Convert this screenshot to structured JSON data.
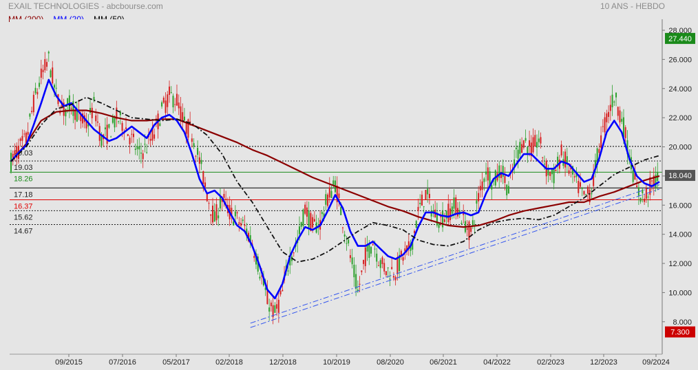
{
  "header": {
    "title": "EXAIL TECHNOLOGIES - abcbourse.com",
    "period": "10 ANS - HEBDO"
  },
  "legend": [
    {
      "label": "MM (200)",
      "color": "#8b0000"
    },
    {
      "label": "MM (20)",
      "color": "#0000ff"
    },
    {
      "label": "MM (50)",
      "color": "#000000"
    }
  ],
  "chart_data": {
    "type": "line",
    "title": "EXAIL TECHNOLOGIES",
    "ylim": [
      7.3,
      28.5
    ],
    "y_ticks": [
      "8.000",
      "10.000",
      "12.000",
      "14.000",
      "16.000",
      "18.000",
      "20.000",
      "22.000",
      "24.000",
      "26.000",
      "28.000"
    ],
    "x_ticks": [
      "09/2015",
      "07/2016",
      "05/2017",
      "02/2018",
      "12/2018",
      "10/2019",
      "08/2020",
      "06/2021",
      "04/2022",
      "02/2023",
      "12/2023",
      "09/2024"
    ],
    "badges": [
      {
        "label": "27.440",
        "value": 27.44,
        "color": "#1a8a1a"
      },
      {
        "label": "18.040",
        "value": 18.04,
        "color": "#555555"
      },
      {
        "label": "7.300",
        "value": 7.3,
        "color": "#cc0000"
      }
    ],
    "horizontal_lines": [
      {
        "label": "20.03",
        "value": 20.03,
        "style": "dotted",
        "color": "#000000"
      },
      {
        "label": "19.03",
        "value": 19.03,
        "style": "dotted",
        "color": "#000000"
      },
      {
        "label": "18.26",
        "value": 18.26,
        "style": "solid",
        "color": "#1a8a1a"
      },
      {
        "label": "17.18",
        "value": 17.18,
        "style": "solid",
        "color": "#000000"
      },
      {
        "label": "16.37",
        "value": 16.37,
        "style": "solid",
        "color": "#e00000"
      },
      {
        "label": "15.62",
        "value": 15.62,
        "style": "dotted",
        "color": "#000000"
      },
      {
        "label": "14.67",
        "value": 14.67,
        "style": "dotted",
        "color": "#000000"
      }
    ],
    "price_series": [
      [
        0,
        19.0
      ],
      [
        4,
        19.8
      ],
      [
        8,
        20.5
      ],
      [
        12,
        23.0
      ],
      [
        16,
        24.8
      ],
      [
        20,
        26.0
      ],
      [
        24,
        23.5
      ],
      [
        28,
        22.5
      ],
      [
        32,
        23.0
      ],
      [
        36,
        22.0
      ],
      [
        40,
        21.5
      ],
      [
        44,
        22.8
      ],
      [
        48,
        20.5
      ],
      [
        52,
        21.0
      ],
      [
        56,
        22.0
      ],
      [
        60,
        21.5
      ],
      [
        64,
        20.5
      ],
      [
        68,
        19.5
      ],
      [
        72,
        20.0
      ],
      [
        76,
        21.0
      ],
      [
        80,
        22.5
      ],
      [
        84,
        23.5
      ],
      [
        88,
        23.2
      ],
      [
        92,
        21.5
      ],
      [
        96,
        21.0
      ],
      [
        100,
        19.0
      ],
      [
        104,
        16.8
      ],
      [
        108,
        15.0
      ],
      [
        112,
        16.5
      ],
      [
        116,
        15.5
      ],
      [
        120,
        15.0
      ],
      [
        124,
        14.5
      ],
      [
        128,
        13.5
      ],
      [
        132,
        11.5
      ],
      [
        136,
        9.5
      ],
      [
        140,
        8.5
      ],
      [
        144,
        10.0
      ],
      [
        148,
        12.5
      ],
      [
        152,
        13.5
      ],
      [
        156,
        15.8
      ],
      [
        160,
        14.5
      ],
      [
        164,
        14.8
      ],
      [
        168,
        16.5
      ],
      [
        172,
        17.5
      ],
      [
        176,
        15.0
      ],
      [
        180,
        12.5
      ],
      [
        184,
        10.0
      ],
      [
        188,
        12.5
      ],
      [
        192,
        13.5
      ],
      [
        196,
        12.0
      ],
      [
        200,
        11.5
      ],
      [
        204,
        11.5
      ],
      [
        208,
        12.5
      ],
      [
        212,
        13.0
      ],
      [
        216,
        15.5
      ],
      [
        220,
        16.8
      ],
      [
        224,
        15.5
      ],
      [
        228,
        15.0
      ],
      [
        232,
        15.5
      ],
      [
        236,
        16.0
      ],
      [
        240,
        15.0
      ],
      [
        244,
        14.0
      ],
      [
        248,
        16.5
      ],
      [
        252,
        18.5
      ],
      [
        256,
        17.5
      ],
      [
        260,
        18.5
      ],
      [
        264,
        17.0
      ],
      [
        268,
        19.5
      ],
      [
        272,
        20.5
      ],
      [
        276,
        19.8
      ],
      [
        280,
        20.5
      ],
      [
        284,
        18.5
      ],
      [
        288,
        18.0
      ],
      [
        292,
        19.5
      ],
      [
        296,
        18.5
      ],
      [
        300,
        17.5
      ],
      [
        304,
        16.5
      ],
      [
        308,
        17.0
      ],
      [
        312,
        20.0
      ],
      [
        316,
        22.0
      ],
      [
        320,
        23.5
      ],
      [
        324,
        22.0
      ],
      [
        328,
        19.5
      ],
      [
        332,
        17.0
      ],
      [
        336,
        16.5
      ],
      [
        340,
        17.5
      ],
      [
        344,
        18.04
      ]
    ],
    "series": [
      {
        "name": "MM (200)",
        "color": "#8b0000",
        "width": 2.2,
        "dash": "",
        "values": [
          [
            0,
            19.0
          ],
          [
            8,
            20.2
          ],
          [
            16,
            21.8
          ],
          [
            24,
            22.4
          ],
          [
            32,
            22.5
          ],
          [
            40,
            22.5
          ],
          [
            48,
            22.3
          ],
          [
            56,
            22.0
          ],
          [
            64,
            21.8
          ],
          [
            72,
            21.8
          ],
          [
            80,
            21.9
          ],
          [
            88,
            21.9
          ],
          [
            96,
            21.5
          ],
          [
            104,
            21.1
          ],
          [
            112,
            20.7
          ],
          [
            120,
            20.3
          ],
          [
            128,
            19.8
          ],
          [
            136,
            19.4
          ],
          [
            144,
            18.9
          ],
          [
            152,
            18.4
          ],
          [
            160,
            17.9
          ],
          [
            168,
            17.5
          ],
          [
            176,
            17.1
          ],
          [
            184,
            16.7
          ],
          [
            192,
            16.3
          ],
          [
            200,
            15.9
          ],
          [
            208,
            15.6
          ],
          [
            216,
            15.2
          ],
          [
            224,
            14.9
          ],
          [
            232,
            14.6
          ],
          [
            240,
            14.5
          ],
          [
            248,
            14.6
          ],
          [
            256,
            14.9
          ],
          [
            264,
            15.3
          ],
          [
            272,
            15.6
          ],
          [
            280,
            15.8
          ],
          [
            288,
            16.0
          ],
          [
            296,
            16.2
          ],
          [
            304,
            16.2
          ],
          [
            312,
            16.6
          ],
          [
            320,
            16.9
          ],
          [
            328,
            17.3
          ],
          [
            336,
            17.7
          ],
          [
            344,
            18.0
          ]
        ]
      },
      {
        "name": "MM (20)",
        "color": "#0000ff",
        "width": 2.6,
        "dash": "",
        "values": [
          [
            0,
            19.0
          ],
          [
            4,
            19.6
          ],
          [
            8,
            20.1
          ],
          [
            12,
            21.5
          ],
          [
            16,
            23.0
          ],
          [
            20,
            24.6
          ],
          [
            24,
            23.5
          ],
          [
            28,
            22.8
          ],
          [
            32,
            23.0
          ],
          [
            36,
            22.4
          ],
          [
            40,
            21.8
          ],
          [
            44,
            21.2
          ],
          [
            48,
            20.8
          ],
          [
            52,
            20.4
          ],
          [
            56,
            20.6
          ],
          [
            60,
            21.0
          ],
          [
            64,
            21.4
          ],
          [
            68,
            21.0
          ],
          [
            72,
            20.6
          ],
          [
            76,
            21.5
          ],
          [
            80,
            22.0
          ],
          [
            84,
            22.2
          ],
          [
            88,
            21.8
          ],
          [
            92,
            21.0
          ],
          [
            96,
            19.5
          ],
          [
            100,
            17.8
          ],
          [
            104,
            16.8
          ],
          [
            108,
            17.0
          ],
          [
            112,
            16.5
          ],
          [
            116,
            15.5
          ],
          [
            120,
            14.6
          ],
          [
            124,
            14.2
          ],
          [
            128,
            13.2
          ],
          [
            132,
            11.8
          ],
          [
            136,
            10.2
          ],
          [
            140,
            9.6
          ],
          [
            144,
            10.6
          ],
          [
            148,
            12.5
          ],
          [
            152,
            13.6
          ],
          [
            156,
            14.5
          ],
          [
            160,
            14.3
          ],
          [
            164,
            14.6
          ],
          [
            168,
            15.6
          ],
          [
            172,
            16.7
          ],
          [
            176,
            15.8
          ],
          [
            180,
            14.2
          ],
          [
            184,
            13.2
          ],
          [
            188,
            13.2
          ],
          [
            192,
            13.5
          ],
          [
            196,
            13.0
          ],
          [
            200,
            12.5
          ],
          [
            204,
            12.3
          ],
          [
            208,
            12.6
          ],
          [
            212,
            13.2
          ],
          [
            216,
            14.5
          ],
          [
            220,
            15.5
          ],
          [
            224,
            15.5
          ],
          [
            228,
            15.3
          ],
          [
            232,
            15.2
          ],
          [
            236,
            15.4
          ],
          [
            240,
            15.5
          ],
          [
            244,
            15.3
          ],
          [
            248,
            15.5
          ],
          [
            252,
            16.8
          ],
          [
            256,
            17.8
          ],
          [
            260,
            18.2
          ],
          [
            264,
            18.0
          ],
          [
            268,
            18.8
          ],
          [
            272,
            19.5
          ],
          [
            276,
            19.5
          ],
          [
            280,
            19.0
          ],
          [
            284,
            18.5
          ],
          [
            288,
            18.5
          ],
          [
            292,
            19.0
          ],
          [
            296,
            18.8
          ],
          [
            300,
            18.2
          ],
          [
            304,
            17.6
          ],
          [
            308,
            17.8
          ],
          [
            312,
            19.2
          ],
          [
            316,
            21.0
          ],
          [
            320,
            21.8
          ],
          [
            324,
            21.0
          ],
          [
            328,
            19.2
          ],
          [
            332,
            18.0
          ],
          [
            336,
            17.5
          ],
          [
            340,
            17.3
          ],
          [
            344,
            17.6
          ]
        ]
      },
      {
        "name": "MM (50)",
        "color": "#111111",
        "width": 1.8,
        "dash": "7,3,2,3",
        "values": [
          [
            0,
            19.0
          ],
          [
            8,
            20.0
          ],
          [
            16,
            21.5
          ],
          [
            24,
            22.6
          ],
          [
            32,
            22.9
          ],
          [
            40,
            23.4
          ],
          [
            48,
            23.0
          ],
          [
            56,
            22.5
          ],
          [
            64,
            22.0
          ],
          [
            72,
            21.9
          ],
          [
            80,
            21.8
          ],
          [
            88,
            21.9
          ],
          [
            96,
            21.6
          ],
          [
            104,
            20.8
          ],
          [
            112,
            19.5
          ],
          [
            120,
            17.6
          ],
          [
            128,
            16.2
          ],
          [
            136,
            14.5
          ],
          [
            144,
            12.8
          ],
          [
            152,
            12.1
          ],
          [
            160,
            12.3
          ],
          [
            168,
            12.8
          ],
          [
            176,
            13.5
          ],
          [
            184,
            14.2
          ],
          [
            192,
            14.8
          ],
          [
            200,
            14.6
          ],
          [
            208,
            14.3
          ],
          [
            216,
            13.6
          ],
          [
            224,
            13.3
          ],
          [
            232,
            13.2
          ],
          [
            240,
            13.5
          ],
          [
            248,
            14.3
          ],
          [
            256,
            14.8
          ],
          [
            264,
            15.0
          ],
          [
            272,
            15.1
          ],
          [
            280,
            15.0
          ],
          [
            288,
            15.3
          ],
          [
            296,
            15.9
          ],
          [
            304,
            16.5
          ],
          [
            312,
            17.3
          ],
          [
            320,
            18.1
          ],
          [
            328,
            18.6
          ],
          [
            336,
            19.1
          ],
          [
            344,
            19.4
          ]
        ]
      }
    ],
    "trend_lines": [
      {
        "from": [
          127,
          7.6
        ],
        "to": [
          344,
          17.1
        ],
        "color": "#3355ee",
        "dash": "8,3,2,3"
      },
      {
        "from": [
          127,
          7.9
        ],
        "to": [
          344,
          17.4
        ],
        "color": "#3355ee",
        "dash": "8,3,2,3"
      }
    ]
  }
}
